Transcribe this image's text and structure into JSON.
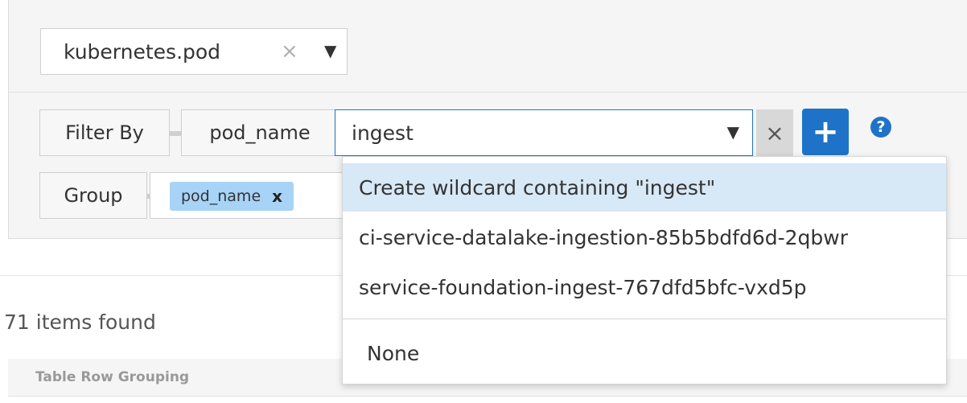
{
  "object_selector": {
    "value": "kubernetes.pod",
    "clear_icon": "×",
    "caret_icon": "▼"
  },
  "filter": {
    "label": "Filter By",
    "field": "pod_name",
    "input_value": "ingest",
    "caret_icon": "▼",
    "clear_icon": "×",
    "add_icon": "+",
    "help_icon": "?"
  },
  "group": {
    "label": "Group",
    "chip_label": "pod_name",
    "chip_remove_icon": "x"
  },
  "dropdown": {
    "options": [
      "Create wildcard containing \"ingest\"",
      "ci-service-datalake-ingestion-85b5bdfd6d-2qbwr",
      "service-foundation-ingest-767dfd5bfc-vxd5p",
      "None"
    ]
  },
  "results": {
    "count_text": "71 items found",
    "table_header": "Table Row Grouping"
  },
  "colors": {
    "accent": "#1e73c8",
    "chip": "#a7d3f7",
    "highlight": "#d7e8f7"
  }
}
